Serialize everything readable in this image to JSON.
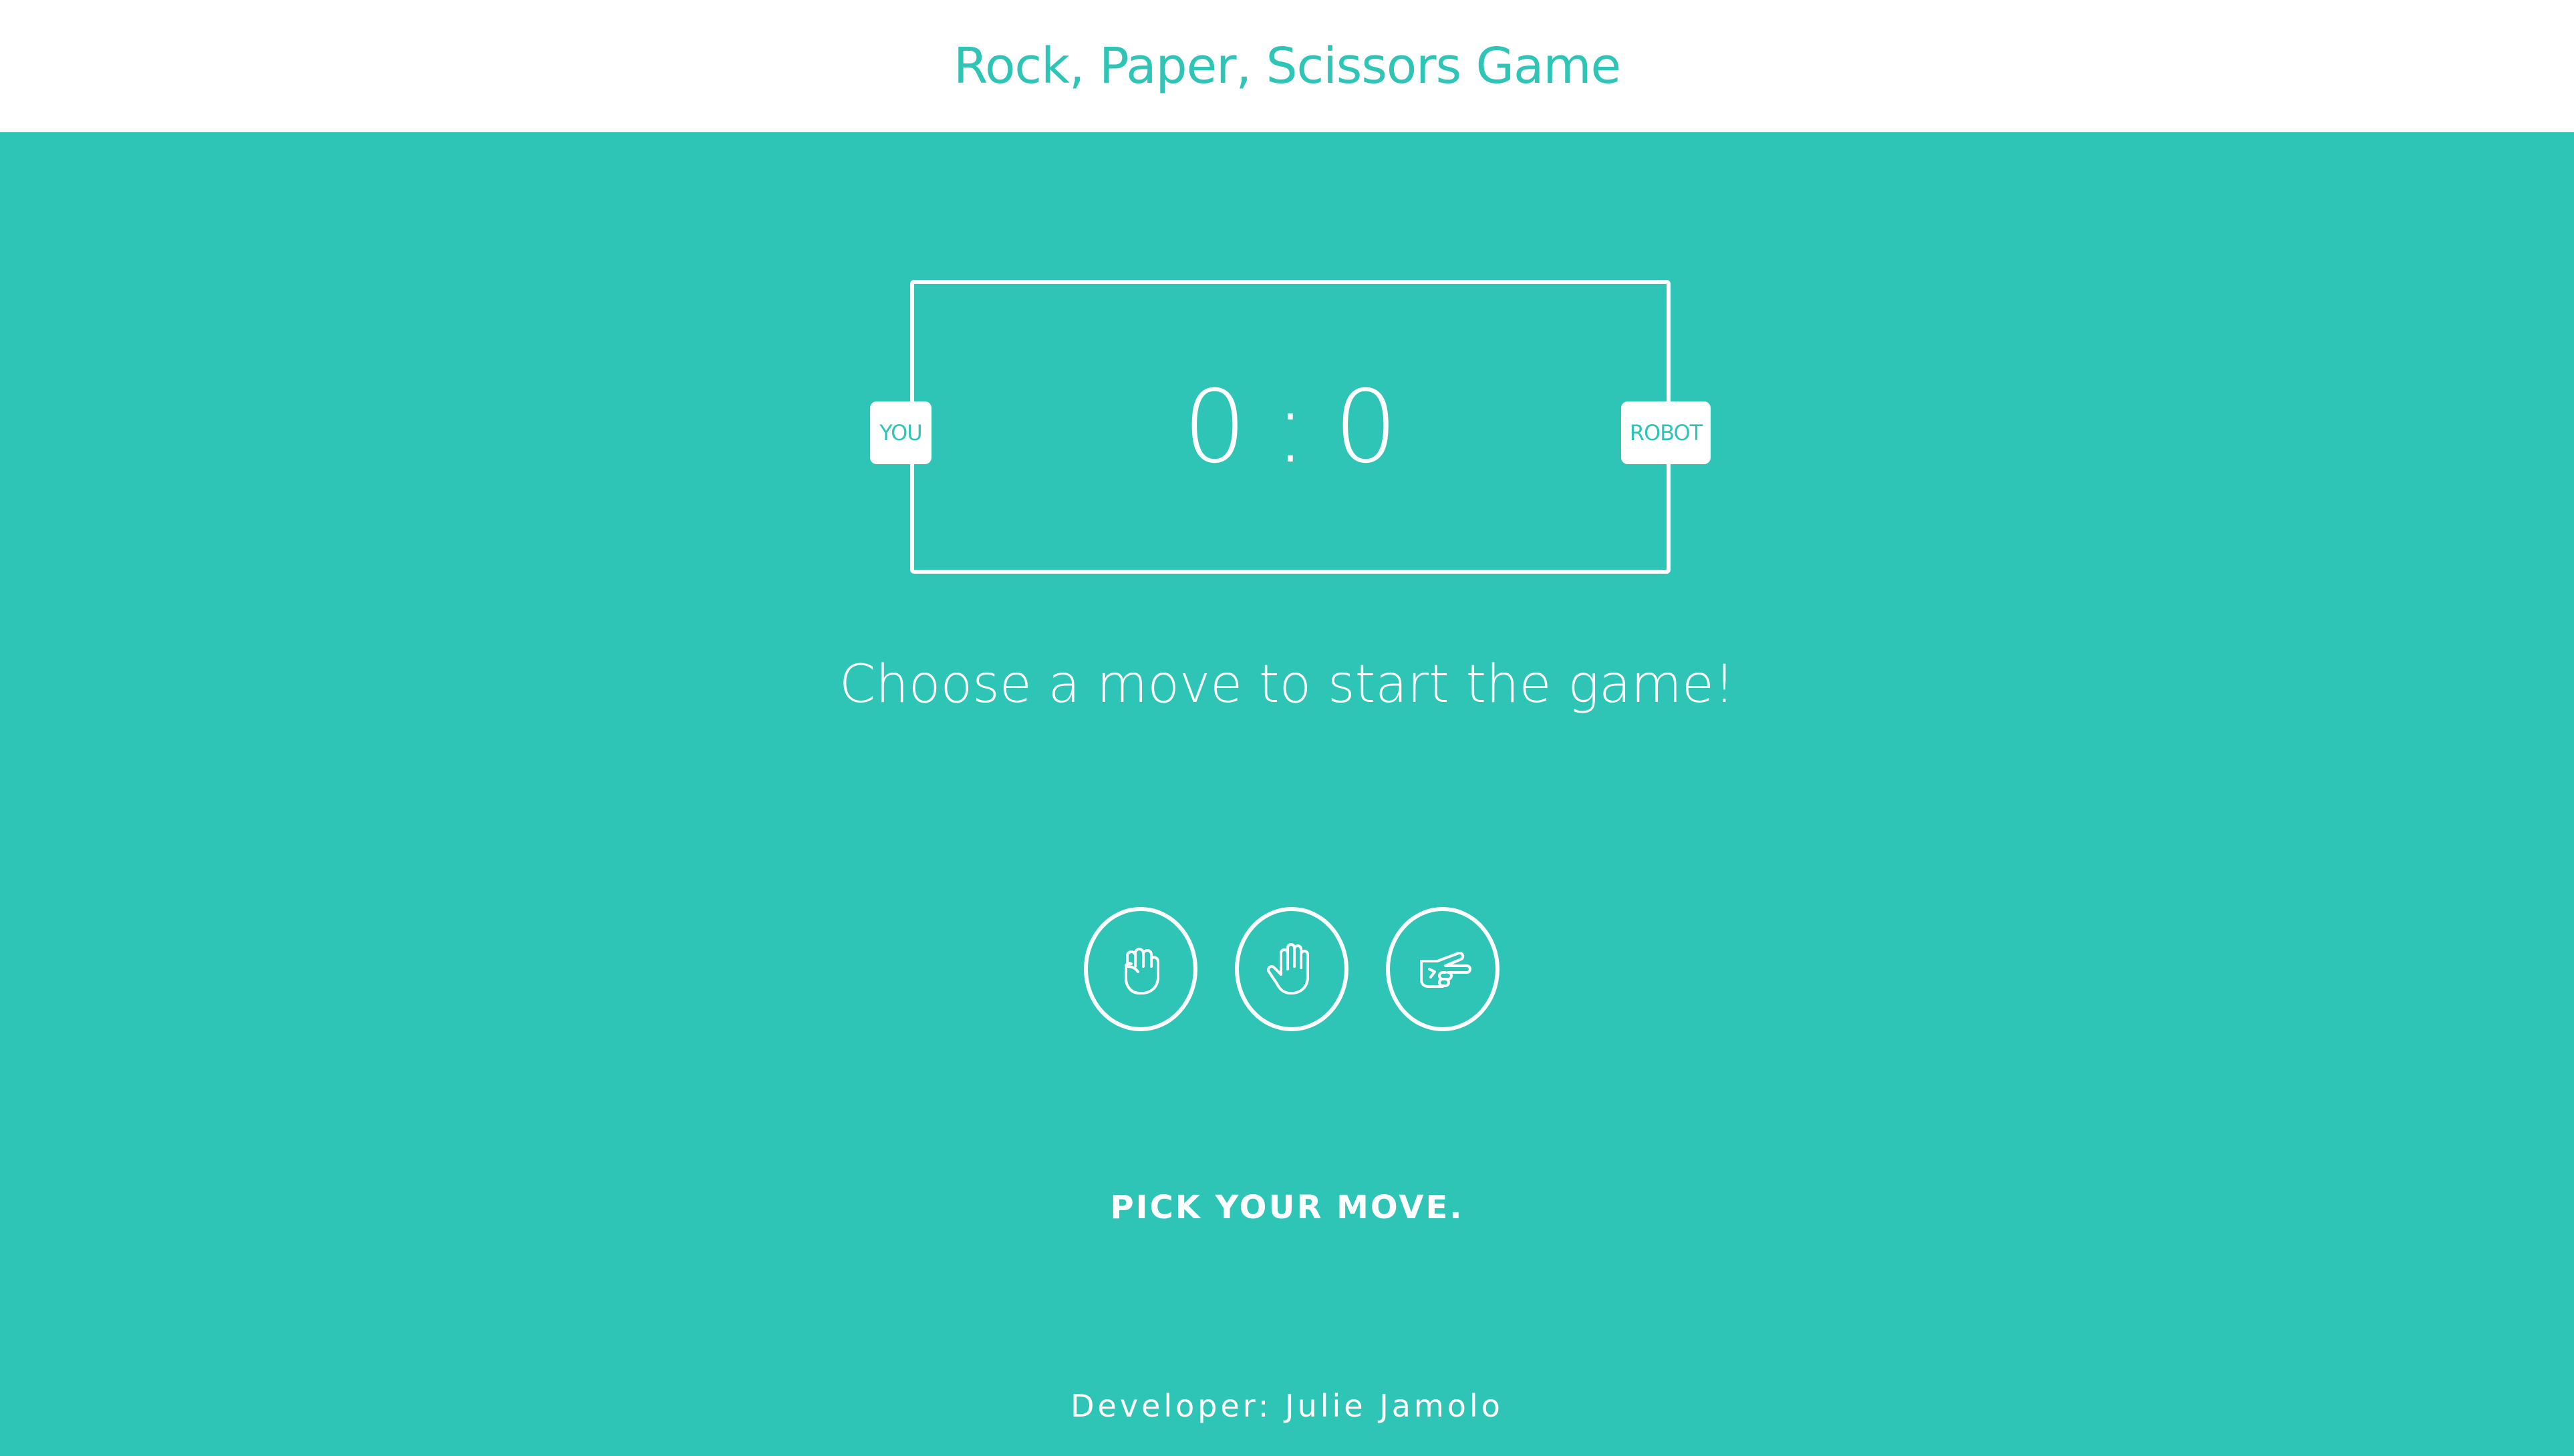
{
  "header": {
    "title": "Rock, Paper, Scissors Game"
  },
  "scoreboard": {
    "player_label": "YOU",
    "robot_label": "ROBOT",
    "player_score": "0",
    "separator": ":",
    "robot_score": "0"
  },
  "message": "Choose a move to start the game!",
  "moves": [
    {
      "name": "rock",
      "icon": "rock-hand-icon"
    },
    {
      "name": "paper",
      "icon": "paper-hand-icon"
    },
    {
      "name": "scissors",
      "icon": "scissors-hand-icon"
    }
  ],
  "prompt": "PICK YOUR MOVE.",
  "footer": {
    "text": "Developer: Julie Jamolo"
  },
  "colors": {
    "accent": "#2ec4b6",
    "foreground": "#ffffff"
  }
}
